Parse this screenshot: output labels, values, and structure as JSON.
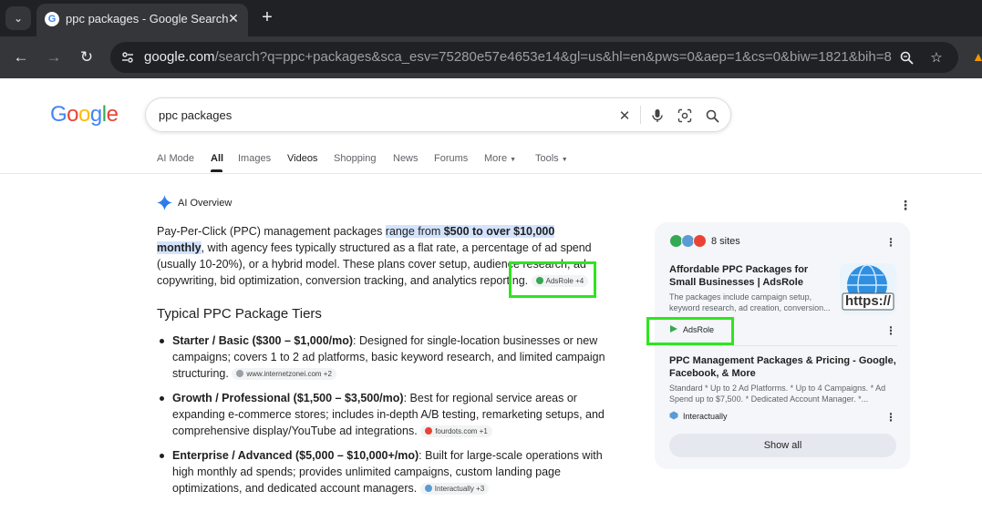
{
  "browser": {
    "tab_title": "ppc packages - Google Search",
    "url_host": "google.com",
    "url_path": "/search?q=ppc+packages&sca_esv=75280e57e4653e14&gl=us&hl=en&pws=0&aep=1&cs=0&biw=1821&bih=844&...",
    "favicon_letter": "G"
  },
  "search": {
    "logo_letters": [
      "G",
      "o",
      "o",
      "g",
      "l",
      "e"
    ],
    "query": "ppc packages"
  },
  "nav_tabs": {
    "ai_mode": "AI Mode",
    "all": "All",
    "images": "Images",
    "videos": "Videos",
    "shopping": "Shopping",
    "news": "News",
    "forums": "Forums",
    "more": "More",
    "tools": "Tools"
  },
  "ai_overview": {
    "label": "AI Overview",
    "intro": {
      "p1": "Pay-Per-Click (PPC) management packages ",
      "hl1": "range from ",
      "hl_bold": "$500 to over $10,000 monthly",
      "p2": ", with agency fees typically structured as a flat rate, a percentage of ad spend (usually 10-20%), or a hybrid model. These plans cover setup, audience research, ad copywriting, bid optimization, conversion tracking, and analytics reporting.",
      "chip": "AdsRole +4"
    },
    "heading": "Typical PPC Package Tiers",
    "tiers": [
      {
        "title": "Starter / Basic ($300 – $1,000/mo)",
        "text": ": Designed for single-location businesses or new campaigns; covers 1 to 2 ad platforms, basic keyword research, and limited campaign structuring.",
        "chip": "www.internetzonei.com +2"
      },
      {
        "title": "Growth / Professional ($1,500 – $3,500/mo)",
        "text": ": Best for regional service areas or expanding e-commerce stores; includes in-depth A/B testing, remarketing setups, and comprehensive display/YouTube ad integrations.",
        "chip": "fourdots.com +1"
      },
      {
        "title": "Enterprise / Advanced ($5,000 – $10,000+/mo)",
        "text": ": Built for large-scale operations with high monthly ad spends; provides unlimited campaigns, custom landing page optimizations, and dedicated account managers.",
        "chip": "Interactually +3"
      }
    ]
  },
  "sources": {
    "count_label": "8 sites",
    "items": [
      {
        "title": "Affordable PPC Packages for Small Businesses | AdsRole",
        "desc": "The packages include campaign setup, keyword research, ad creation, conversion...",
        "site": "AdsRole",
        "thumb_text": "https://"
      },
      {
        "title": "PPC Management Packages & Pricing - Google, Facebook, & More",
        "desc": "Standard * Up to 2 Ad Platforms. * Up to 4 Campaigns. * Ad Spend up to $7,500. * Dedicated Account Manager. *...",
        "site": "Interactually"
      }
    ],
    "show_all": "Show all"
  },
  "colors": {
    "highlight": "#d3e3fd",
    "annotation_box": "#2ee51f",
    "chrome_dark": "#202124"
  }
}
